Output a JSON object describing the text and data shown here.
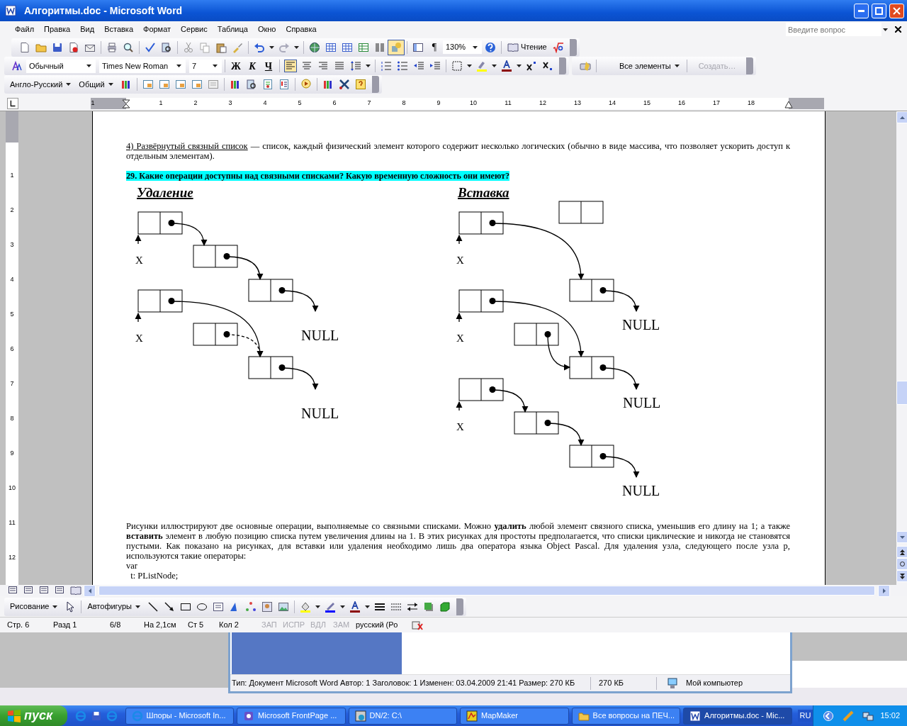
{
  "window": {
    "title": "Алгоритмы.doc - Microsoft Word"
  },
  "menu": [
    {
      "label": "Файл"
    },
    {
      "label": "Правка"
    },
    {
      "label": "Вид"
    },
    {
      "label": "Вставка"
    },
    {
      "label": "Формат"
    },
    {
      "label": "Сервис"
    },
    {
      "label": "Таблица"
    },
    {
      "label": "Окно"
    },
    {
      "label": "Справка"
    }
  ],
  "help_search": {
    "placeholder": "Введите вопрос"
  },
  "standard_toolbar": {
    "drawing_toggle": {
      "on": true
    },
    "pilcrow": "¶",
    "zoom": "130%",
    "reading": "Чтение"
  },
  "formatting_toolbar": {
    "style": "Обычный",
    "font": "Times New Roman",
    "size": "7",
    "bold": "Ж",
    "italic": "К",
    "underline": "Ч",
    "align_buttons": [
      {
        "selected": true
      },
      {
        "selected": false
      },
      {
        "selected": false
      },
      {
        "selected": false
      }
    ],
    "elements": "Все элементы",
    "create": {
      "label": "Создать…",
      "disabled": true
    }
  },
  "translation_toolbar": {
    "dictionary": "Англо-Русский",
    "category": "Общий"
  },
  "rulers": {
    "horizontal": [
      "1",
      "1",
      "2",
      "3",
      "4",
      "5",
      "6",
      "7",
      "8",
      "9",
      "10",
      "11",
      "12",
      "13",
      "14",
      "15",
      "16",
      "17",
      "18"
    ],
    "vertical": [
      "1",
      "2",
      "3",
      "4",
      "5",
      "6",
      "7",
      "8",
      "9",
      "10",
      "11",
      "12"
    ]
  },
  "document": {
    "paragraph_1": {
      "term": "4) Развёрнутый связный список",
      "text": " — список, каждый физический элемент которого содержит несколько логических (обычно в виде массива, что позволяет ускорить доступ к отдельным элементам)."
    },
    "heading": "29. Какие операции доступны над связными списками? Какую временную сложность они имеют?",
    "diagram": {
      "deletion": {
        "title": "Удаление",
        "pointer_labels": [
          "X",
          "X"
        ],
        "null_labels": [
          "NULL",
          "NULL"
        ]
      },
      "insertion": {
        "title": "Вставка",
        "pointer_labels": [
          "X",
          "X",
          "X"
        ],
        "null_labels": [
          "NULL",
          "NULL",
          "NULL"
        ]
      }
    },
    "paragraph_2": "Рисунки иллюстрируют две основные операции, выполняемые со связными списками. Можно **удалить** любой элемент связного списка, уменьшив его длину на 1; а также **вставить** элемент в любую позицию списка путем увеличения длины на 1. В этих рисунках для простоты предполагается, что списки циклические и никогда не становятся пустыми. Как показано на рисунках, для вставки или удаления необходимо лишь два оператора языка Object Pascal. Для удаления узла, следующего после узла p, используются такие операторы:",
    "code": [
      "var",
      "  t: PListNode;"
    ]
  },
  "drawing_toolbar": {
    "drawing": "Рисование",
    "autoshapes": "Автофигуры"
  },
  "status_bar": [
    {
      "text": "Стр. 6",
      "disabled": false
    },
    {
      "text": "Разд 1",
      "disabled": false
    },
    {
      "text": "6/8",
      "disabled": false
    },
    {
      "text": "На 2,1см",
      "disabled": false
    },
    {
      "text": "Ст 5",
      "disabled": false
    },
    {
      "text": "Кол 2",
      "disabled": false
    },
    {
      "text": "ЗАП",
      "disabled": true
    },
    {
      "text": "ИСПР",
      "disabled": true
    },
    {
      "text": "ВДЛ",
      "disabled": true
    },
    {
      "text": "ЗАМ",
      "disabled": true
    },
    {
      "text": "русский (Ро",
      "disabled": false
    }
  ],
  "explorer": {
    "status": "Тип: Документ Microsoft Word Автор: 1 Заголовок: 1 Изменен: 03.04.2009 21:41 Размер: 270 КБ",
    "size": "270 КБ",
    "location": "Мой компьютер"
  },
  "taskbar": {
    "start": "пуск",
    "tasks": [
      {
        "label": "Шпоры - Microsoft In...",
        "selected": false
      },
      {
        "label": "Microsoft FrontPage ...",
        "selected": false
      },
      {
        "label": "DN/2: C:\\",
        "selected": false
      },
      {
        "label": "MapMaker",
        "selected": false
      },
      {
        "label": "Все вопросы на ПЕЧ...",
        "selected": false
      },
      {
        "label": "Алгоритмы.doc - Mic...",
        "selected": true
      }
    ],
    "language": "RU",
    "clock": "15:02"
  }
}
